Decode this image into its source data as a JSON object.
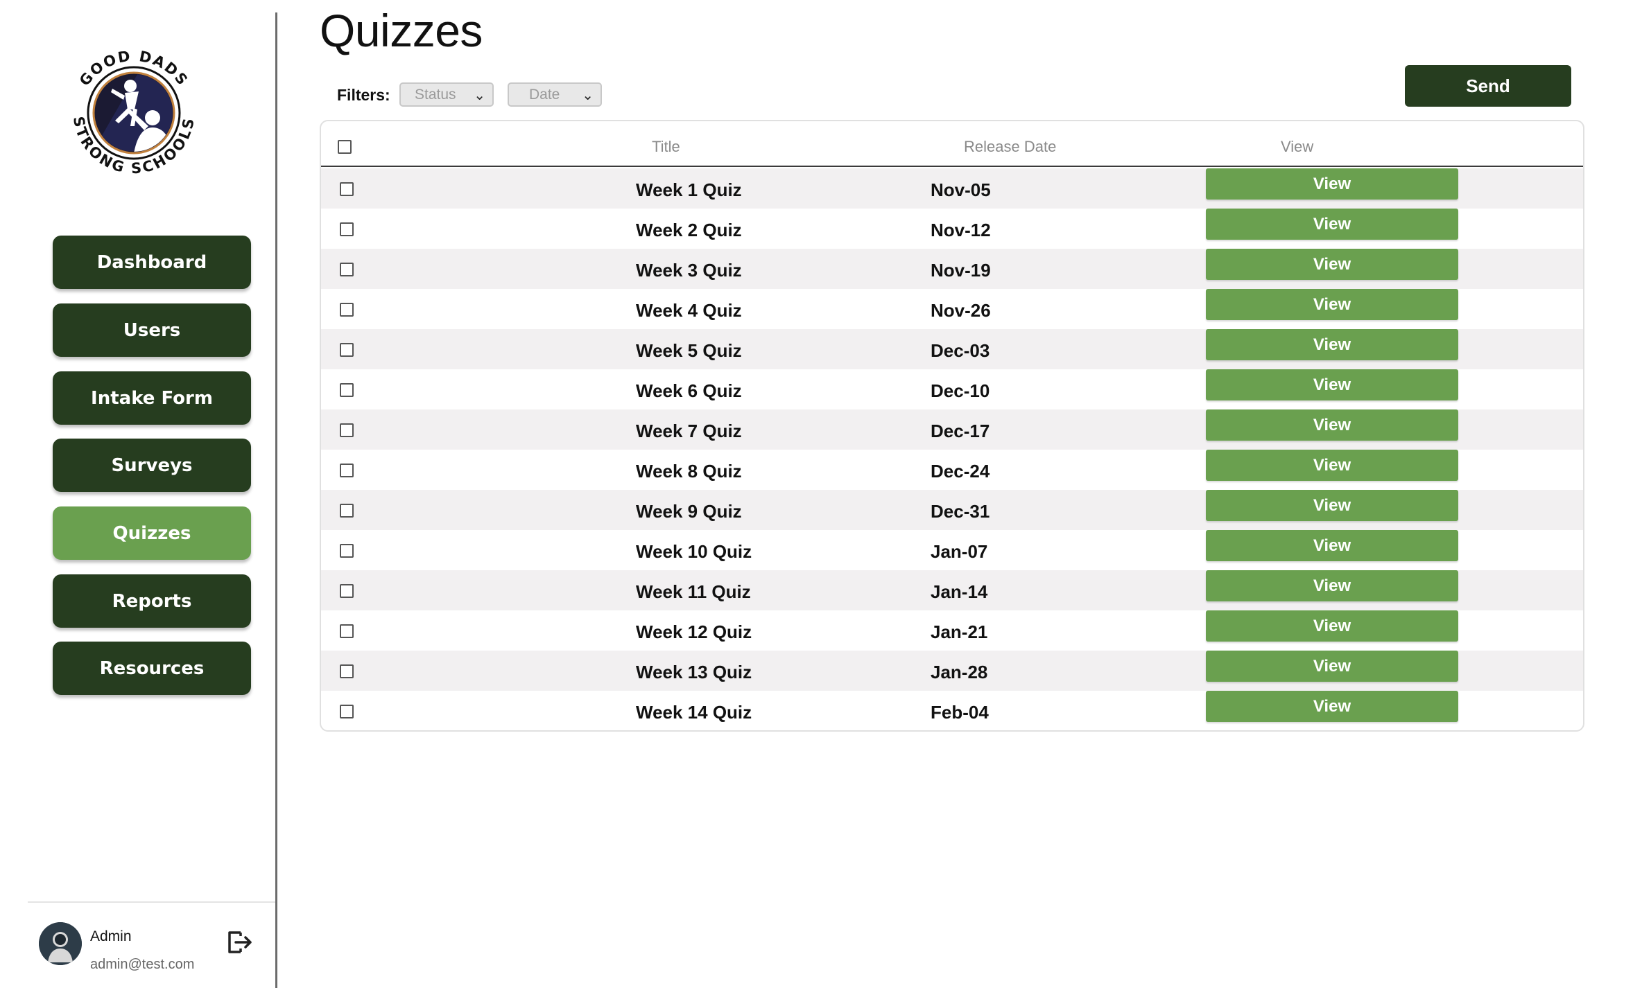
{
  "app": {
    "logo_top_text": "GOOD DADS",
    "logo_bottom_text": "STRONG SCHOOLS"
  },
  "sidebar": {
    "items": [
      {
        "label": "Dashboard",
        "active": false
      },
      {
        "label": "Users",
        "active": false
      },
      {
        "label": "Intake Form",
        "active": false
      },
      {
        "label": "Surveys",
        "active": false
      },
      {
        "label": "Quizzes",
        "active": true
      },
      {
        "label": "Reports",
        "active": false
      },
      {
        "label": "Resources",
        "active": false
      }
    ],
    "user": {
      "name": "Admin",
      "email": "admin@test.com",
      "avatar_icon": "user-avatar-icon",
      "logout_icon": "logout-icon"
    }
  },
  "main": {
    "title": "Quizzes",
    "filters": {
      "label": "Filters:",
      "status_placeholder": "Status",
      "date_placeholder": "Date"
    },
    "send_label": "Send",
    "table": {
      "headers": {
        "title": "Title",
        "release_date": "Release Date",
        "view": "View"
      },
      "rows": [
        {
          "title": "Week 1 Quiz",
          "date": "Nov-05",
          "action": "View"
        },
        {
          "title": "Week 2 Quiz",
          "date": "Nov-12",
          "action": "View"
        },
        {
          "title": "Week 3 Quiz",
          "date": "Nov-19",
          "action": "View"
        },
        {
          "title": "Week 4 Quiz",
          "date": "Nov-26",
          "action": "View"
        },
        {
          "title": "Week 5 Quiz",
          "date": "Dec-03",
          "action": "View"
        },
        {
          "title": "Week 6 Quiz",
          "date": "Dec-10",
          "action": "View"
        },
        {
          "title": "Week 7 Quiz",
          "date": "Dec-17",
          "action": "View"
        },
        {
          "title": "Week 8 Quiz",
          "date": "Dec-24",
          "action": "View"
        },
        {
          "title": "Week 9 Quiz",
          "date": "Dec-31",
          "action": "View"
        },
        {
          "title": "Week 10 Quiz",
          "date": "Jan-07",
          "action": "View"
        },
        {
          "title": "Week 11 Quiz",
          "date": "Jan-14",
          "action": "View"
        },
        {
          "title": "Week 12 Quiz",
          "date": "Jan-21",
          "action": "View"
        },
        {
          "title": "Week 13 Quiz",
          "date": "Jan-28",
          "action": "View"
        },
        {
          "title": "Week 14 Quiz",
          "date": "Feb-04",
          "action": "View"
        }
      ]
    }
  },
  "colors": {
    "primary_dark": "#263d1f",
    "accent_green": "#6aa04f",
    "row_stripe": "#f2f0f1"
  }
}
